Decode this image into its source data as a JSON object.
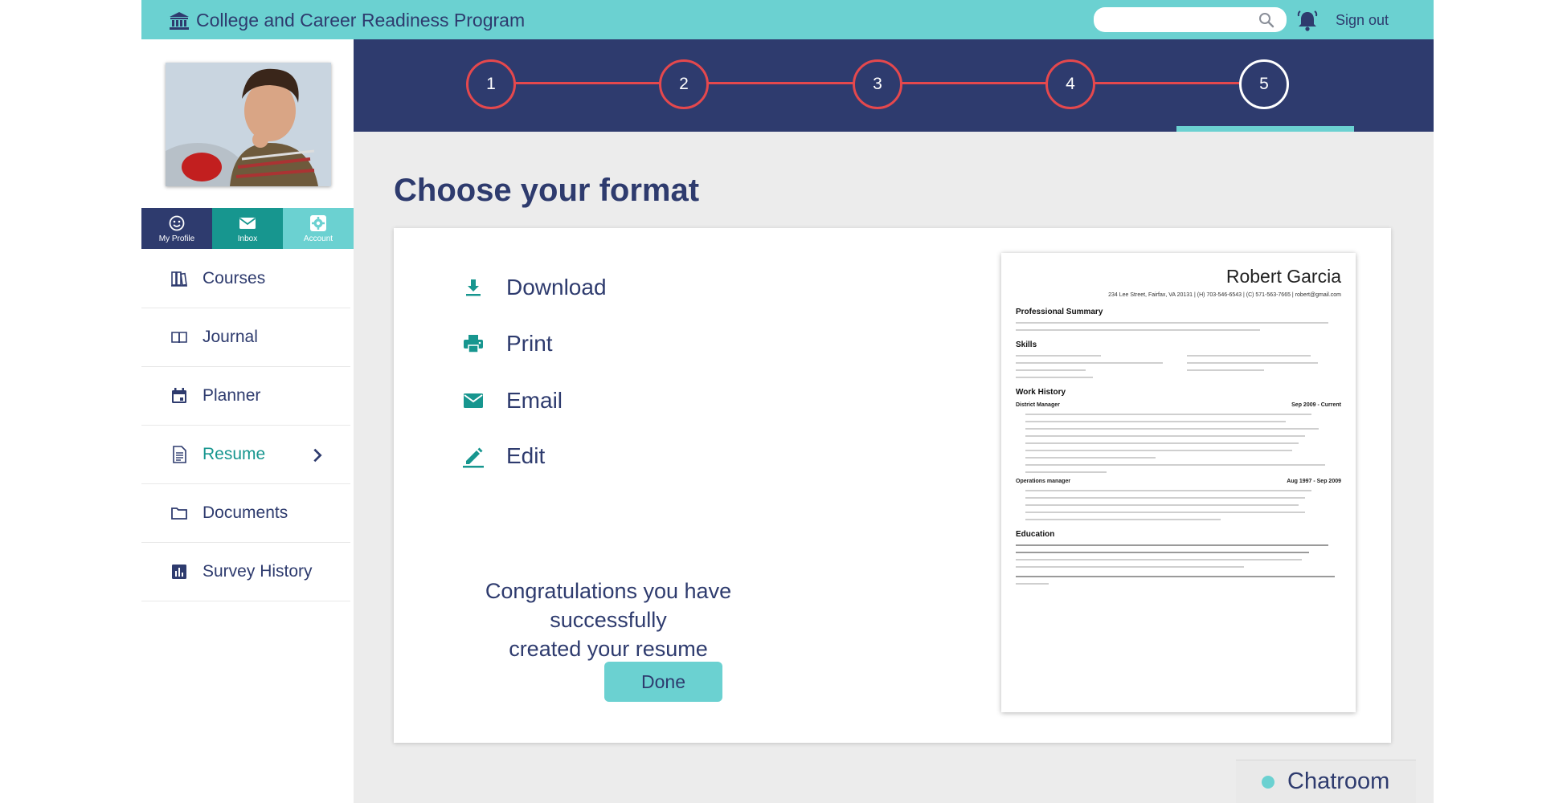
{
  "header": {
    "title": "College and Career Readiness Program",
    "search_placeholder": "",
    "signout_label": "Sign out"
  },
  "sidebar": {
    "quick_links": [
      {
        "label": "My Profile",
        "icon": "smiley-icon"
      },
      {
        "label": "Inbox",
        "icon": "mail-icon"
      },
      {
        "label": "Account",
        "icon": "gear-icon"
      }
    ],
    "items": [
      {
        "label": "Courses",
        "icon": "books-icon"
      },
      {
        "label": "Journal",
        "icon": "open-book-icon"
      },
      {
        "label": "Planner",
        "icon": "calendar-icon"
      },
      {
        "label": "Resume",
        "icon": "document-icon",
        "active": true
      },
      {
        "label": "Documents",
        "icon": "folder-icon"
      },
      {
        "label": "Survey History",
        "icon": "bar-chart-icon"
      }
    ]
  },
  "stepper": {
    "steps": [
      "1",
      "2",
      "3",
      "4",
      "5"
    ],
    "current_step": 5
  },
  "main": {
    "heading": "Choose your format",
    "options": [
      {
        "label": "Download",
        "icon": "download-icon"
      },
      {
        "label": "Print",
        "icon": "printer-icon"
      },
      {
        "label": "Email",
        "icon": "mail-icon"
      },
      {
        "label": "Edit",
        "icon": "pencil-icon"
      }
    ],
    "congrats_line1": "Congratulations you have successfully",
    "congrats_line2": "created your resume",
    "done_label": "Done"
  },
  "resume": {
    "name": "Robert Garcia",
    "contact": "234 Lee Street, Fairfax, VA 20131 | (H) 703-546-6543 | (C) 571-563-7665 | robert@gmail.com",
    "sections": {
      "summary": "Professional Summary",
      "skills": "Skills",
      "work": "Work History",
      "education": "Education"
    },
    "roles": [
      {
        "title": "District Manager",
        "dates": "Sep 2009 - Current"
      },
      {
        "title": "Operations manager",
        "dates": "Aug 1997 - Sep 2009"
      }
    ]
  },
  "chat": {
    "label": "Chatroom"
  },
  "colors": {
    "navy": "#2e3b6e",
    "teal": "#6bd1d1",
    "dark_teal": "#17968f",
    "step_red": "#e5484d",
    "page_bg": "#ececec"
  }
}
